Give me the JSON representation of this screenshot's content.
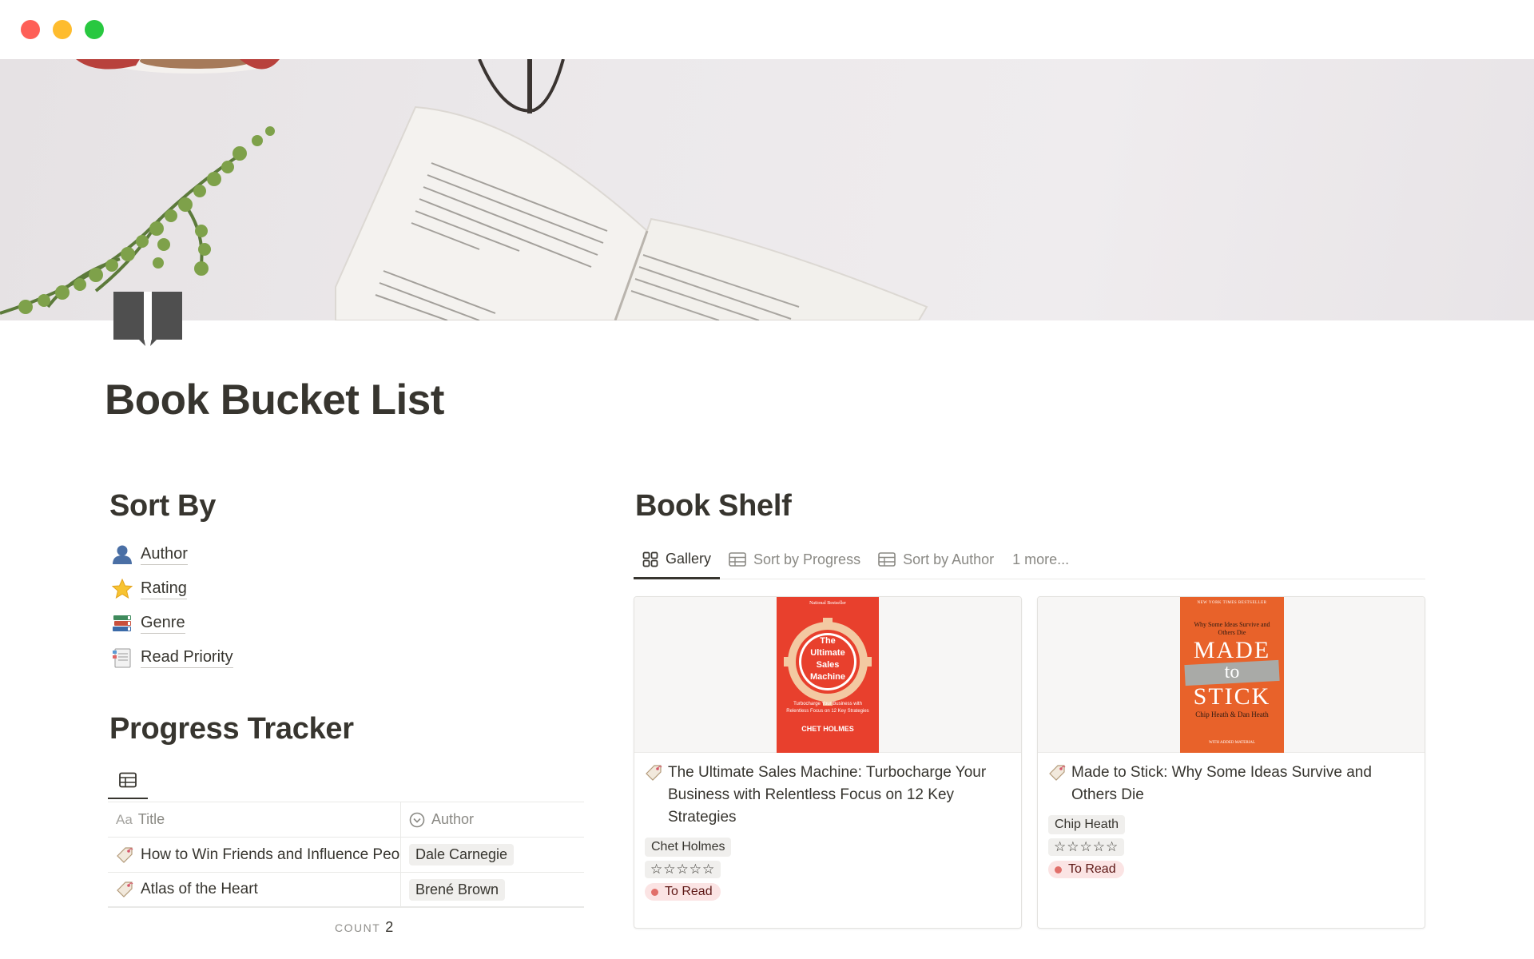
{
  "page": {
    "title": "Book Bucket List",
    "icon": "open-book-icon"
  },
  "sort_by": {
    "heading": "Sort By",
    "items": [
      {
        "icon": "person-icon",
        "label": "Author"
      },
      {
        "icon": "star-icon",
        "label": "Rating"
      },
      {
        "icon": "books-icon",
        "label": "Genre"
      },
      {
        "icon": "bookmark-tabs-icon",
        "label": "Read Priority"
      }
    ]
  },
  "progress_tracker": {
    "heading": "Progress Tracker",
    "view_icon": "table-icon",
    "columns": {
      "title_prefix": "Aa",
      "title": "Title",
      "author": "Author"
    },
    "rows": [
      {
        "title": "How to Win Friends and Influence People",
        "author": "Dale Carnegie"
      },
      {
        "title": "Atlas of the Heart",
        "author": "Brené Brown"
      }
    ],
    "count_label": "COUNT",
    "count_value": "2"
  },
  "book_shelf": {
    "heading": "Book Shelf",
    "tabs": [
      {
        "label": "Gallery",
        "icon": "gallery-icon",
        "active": true
      },
      {
        "label": "Sort by Progress",
        "icon": "table-icon",
        "active": false
      },
      {
        "label": "Sort by Author",
        "icon": "table-icon",
        "active": false
      },
      {
        "label": "1 more...",
        "icon": "",
        "active": false
      }
    ],
    "cards": [
      {
        "title": "The Ultimate Sales Machine: Turbocharge Your Business with Relentless Focus on 12 Key Strategies",
        "author": "Chet Holmes",
        "rating": "☆☆☆☆☆",
        "status": "To Read",
        "cover": {
          "top_line": "National Bestseller",
          "title_lines": [
            "The",
            "Ultimate",
            "Sales",
            "Machine"
          ],
          "subtitle": "Turbocharge Your Business with Relentless Focus on 12 Key Strategies",
          "author": "CHET HOLMES",
          "bg": "#e8402d"
        }
      },
      {
        "title": "Made to Stick: Why Some Ideas Survive and Others Die",
        "author": "Chip Heath",
        "rating": "☆☆☆☆☆",
        "status": "To Read",
        "cover": {
          "top_line": "NEW YORK TIMES BESTSELLER",
          "subtitle": "Why Some Ideas Survive and Others Die",
          "title_lines": [
            "MADE",
            "to",
            "STICK"
          ],
          "author": "Chip Heath & Dan Heath",
          "bottom_line": "WITH ADDED MATERIAL",
          "bg": "#e8622a"
        }
      }
    ]
  },
  "colors": {
    "text": "#37352f",
    "muted": "#8a8984",
    "status_bg": "#fbe4e4",
    "status_dot": "#e16f6a",
    "tag_bg": "#f0efed"
  }
}
